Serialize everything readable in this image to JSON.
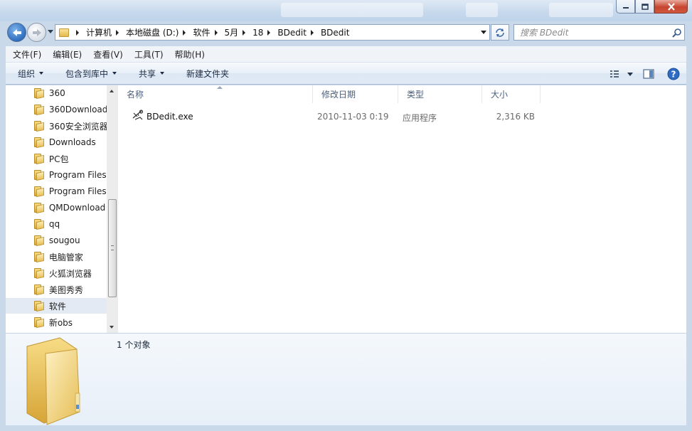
{
  "window": {
    "controls": {
      "minimize_icon": "minimize-icon",
      "maximize_icon": "maximize-icon",
      "close_icon": "close-icon"
    }
  },
  "navigation": {
    "breadcrumbs": [
      "计算机",
      "本地磁盘 (D:)",
      "软件",
      "5月",
      "18",
      "BDedit",
      "BDedit"
    ],
    "search_placeholder": "搜索 BDedit"
  },
  "menubar": {
    "items": [
      "文件(F)",
      "编辑(E)",
      "查看(V)",
      "工具(T)",
      "帮助(H)"
    ]
  },
  "toolbar": {
    "organize": "组织",
    "include_in_library": "包含到库中",
    "share": "共享",
    "new_folder": "新建文件夹"
  },
  "sidebar": {
    "items": [
      {
        "label": "360"
      },
      {
        "label": "360Download"
      },
      {
        "label": "360安全浏览器"
      },
      {
        "label": "Downloads"
      },
      {
        "label": "PC包"
      },
      {
        "label": "Program Files"
      },
      {
        "label": "Program Files"
      },
      {
        "label": "QMDownload"
      },
      {
        "label": "qq"
      },
      {
        "label": "sougou"
      },
      {
        "label": "电脑管家"
      },
      {
        "label": "火狐浏览器"
      },
      {
        "label": "美图秀秀"
      },
      {
        "label": "软件",
        "selected": true
      },
      {
        "label": "新obs"
      }
    ]
  },
  "file_list": {
    "columns": [
      "名称",
      "修改日期",
      "类型",
      "大小"
    ],
    "rows": [
      {
        "name": "BDedit.exe",
        "modified": "2010-11-03 0:19",
        "type": "应用程序",
        "size": "2,316 KB"
      }
    ]
  },
  "details_pane": {
    "status": "1 个对象"
  },
  "colors": {
    "chrome": "#c9d9ea",
    "selection": "#e3eaf3",
    "close_button": "#c7452f"
  }
}
